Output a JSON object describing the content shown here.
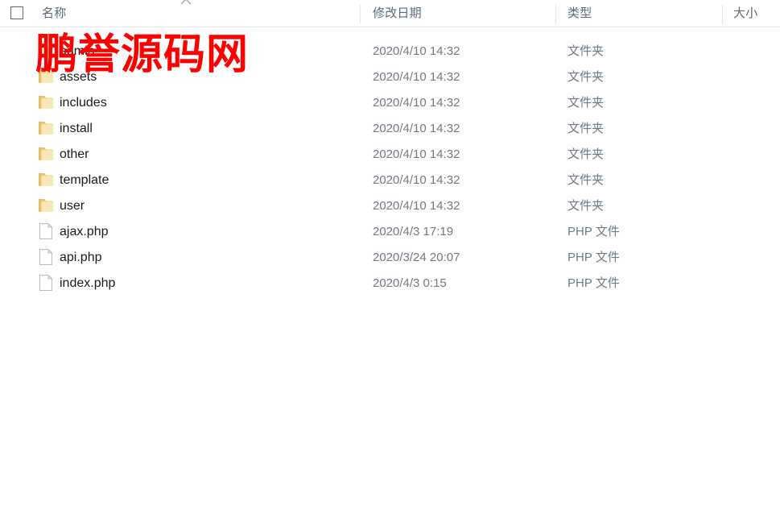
{
  "watermark": {
    "text": "鹏誉源码网",
    "color": "#ff0000"
  },
  "header": {
    "select_all_label": "",
    "sort_indicator_icon": "chevron-up-icon",
    "columns": [
      {
        "key": "name",
        "label": "名称"
      },
      {
        "key": "date",
        "label": "修改日期"
      },
      {
        "key": "type",
        "label": "类型"
      },
      {
        "key": "size",
        "label": "大小"
      }
    ]
  },
  "rows": [
    {
      "icon": "folder-icon",
      "name": "admin",
      "date": "2020/4/10 14:32",
      "type": "文件夹",
      "size": ""
    },
    {
      "icon": "folder-icon",
      "name": "assets",
      "date": "2020/4/10 14:32",
      "type": "文件夹",
      "size": ""
    },
    {
      "icon": "folder-icon",
      "name": "includes",
      "date": "2020/4/10 14:32",
      "type": "文件夹",
      "size": ""
    },
    {
      "icon": "folder-icon",
      "name": "install",
      "date": "2020/4/10 14:32",
      "type": "文件夹",
      "size": ""
    },
    {
      "icon": "folder-icon",
      "name": "other",
      "date": "2020/4/10 14:32",
      "type": "文件夹",
      "size": ""
    },
    {
      "icon": "folder-icon",
      "name": "template",
      "date": "2020/4/10 14:32",
      "type": "文件夹",
      "size": ""
    },
    {
      "icon": "folder-icon",
      "name": "user",
      "date": "2020/4/10 14:32",
      "type": "文件夹",
      "size": ""
    },
    {
      "icon": "file-icon",
      "name": "ajax.php",
      "date": "2020/4/3 17:19",
      "type": "PHP 文件",
      "size": ""
    },
    {
      "icon": "file-icon",
      "name": "api.php",
      "date": "2020/3/24 20:07",
      "type": "PHP 文件",
      "size": ""
    },
    {
      "icon": "file-icon",
      "name": "index.php",
      "date": "2020/4/3 0:15",
      "type": "PHP 文件",
      "size": ""
    }
  ],
  "colors": {
    "folder_icon": "#f5d98a",
    "folder_icon_dark": "#e8c濃",
    "header_text": "#5b6a78",
    "name_text": "#1b1b1b",
    "meta_text": "#6e7b88",
    "divider": "#e3e6ea"
  }
}
